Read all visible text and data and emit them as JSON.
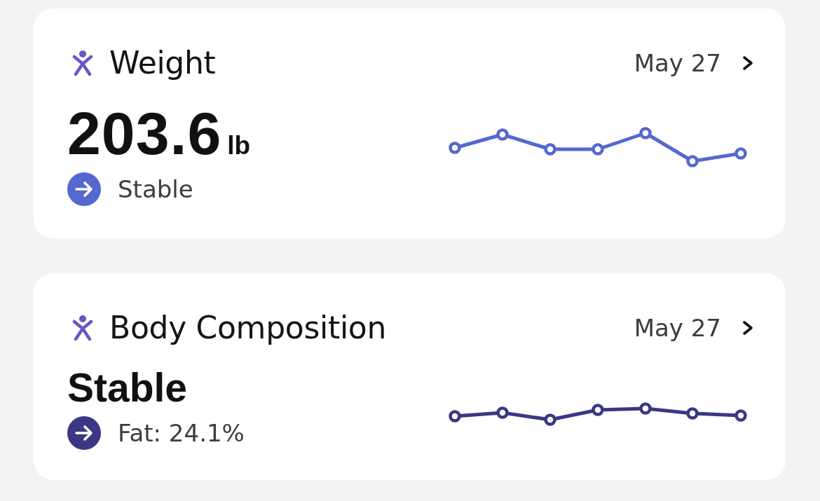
{
  "cards": [
    {
      "kind": "measurement",
      "title": "Weight",
      "date": "May 27",
      "value": "203.6",
      "unit": "lb",
      "trend": {
        "text": "Stable",
        "color": "#5468d0"
      }
    },
    {
      "kind": "status",
      "title": "Body Composition",
      "date": "May 27",
      "status": "Stable",
      "trend": {
        "text": "Fat: 24.1%",
        "color": "#3a3784"
      }
    }
  ]
}
